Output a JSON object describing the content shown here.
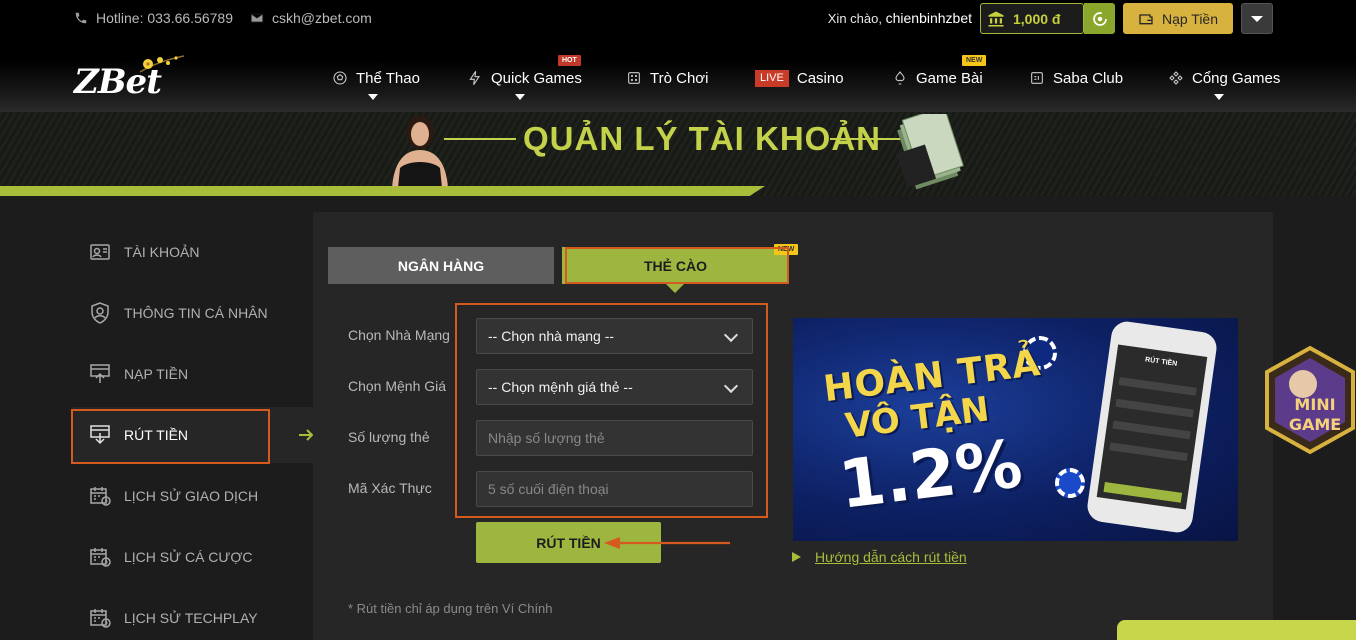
{
  "topbar": {
    "hotline": "Hotline: 033.66.56789",
    "email": "cskh@zbet.com",
    "greeting_prefix": "Xin chào,",
    "username": "chienbinhzbet",
    "balance": "1,000 đ",
    "deposit_label": "Nạp Tiền"
  },
  "logo": {
    "text": "ZBet"
  },
  "nav": {
    "items": [
      {
        "label": "Thể Thao",
        "icon": "soccer-ball-icon"
      },
      {
        "label": "Quick Games",
        "icon": "lightning-icon",
        "badge": "HOT"
      },
      {
        "label": "Trò Chơi",
        "icon": "dice-icon"
      },
      {
        "label": "Casino",
        "tag": "LIVE"
      },
      {
        "label": "Game Bài",
        "icon": "card-icon",
        "badge": "NEW"
      },
      {
        "label": "Saba Club",
        "icon": "sb-icon"
      },
      {
        "label": "Cổng Games",
        "icon": "gamepad-icon"
      }
    ]
  },
  "banner": {
    "title": "QUẢN LÝ TÀI KHOẢN"
  },
  "sidebar": {
    "items": [
      {
        "label": "TÀI KHOẢN",
        "icon": "account-icon"
      },
      {
        "label": "THÔNG TIN CÁ NHÂN",
        "icon": "profile-shield-icon"
      },
      {
        "label": "NẠP TIỀN",
        "icon": "deposit-icon"
      },
      {
        "label": "RÚT TIỀN",
        "icon": "withdraw-icon",
        "active": true
      },
      {
        "label": "LỊCH SỬ GIAO DỊCH",
        "icon": "calendar-history-icon"
      },
      {
        "label": "LỊCH SỬ CÁ CƯỢC",
        "icon": "calendar-history-icon"
      },
      {
        "label": "LỊCH SỬ TECHPLAY",
        "icon": "calendar-history-icon"
      }
    ]
  },
  "tabs": {
    "bank": "NGÂN HÀNG",
    "card": "THẺ CÀO",
    "card_badge": "NEW"
  },
  "form": {
    "network_label": "Chọn Nhà Mạng",
    "network_value": "-- Chọn nhà mạng --",
    "value_label": "Chọn Mệnh Giá",
    "value_value": "-- Chọn mệnh giá thẻ --",
    "qty_label": "Số lượng thẻ",
    "qty_placeholder": "Nhập số lượng thẻ",
    "verify_label": "Mã Xác Thực",
    "verify_placeholder": "5 số cuối điện thoại",
    "submit": "RÚT TIỀN",
    "note": "* Rút tiền chỉ áp dụng trên Ví Chính"
  },
  "promo": {
    "line1": "HOÀN TRẢ",
    "line2": "VÔ TẬN",
    "percent": "1.2%",
    "phone_title": "RÚT TIỀN"
  },
  "guide_link": "Hướng dẫn cách rút tiền",
  "mini_game": {
    "line1": "MINI",
    "line2": "GAME"
  },
  "colors": {
    "accent_green": "#9db640",
    "gold": "#d8b23f",
    "highlight_orange": "#d45a1f"
  }
}
